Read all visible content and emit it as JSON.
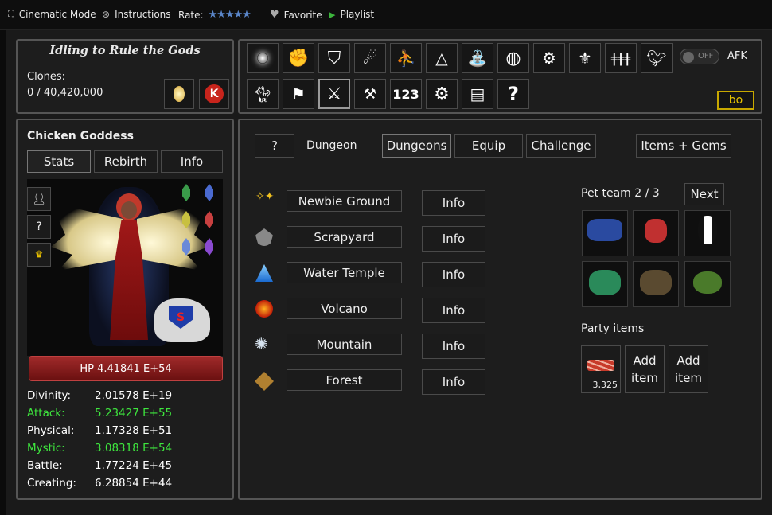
{
  "topbar": {
    "cinematic": "Cinematic Mode",
    "instructions": "Instructions",
    "rate": "Rate:",
    "stars": "★★★★★",
    "favorite": "Favorite",
    "playlist": "Playlist"
  },
  "header": {
    "title": "Idling to Rule the Gods",
    "clones_label": "Clones:",
    "clones_value": "0 / 40,420,000"
  },
  "toolbar": {
    "afk_toggle": "OFF",
    "afk_label": "AFK",
    "bo_label": "bo",
    "number_icon": "123",
    "help_icon": "?"
  },
  "character": {
    "name": "Chicken Goddess",
    "tabs": [
      "Stats",
      "Rebirth",
      "Info"
    ],
    "side_buttons": [
      "person-icon",
      "?",
      "crown-icon"
    ],
    "hp": "HP 4.41841 E+54",
    "stats": [
      {
        "label": "Divinity:",
        "value": "2.01578 E+19",
        "highlight": false
      },
      {
        "label": "Attack:",
        "value": "5.23427 E+55",
        "highlight": true
      },
      {
        "label": "Physical:",
        "value": "1.17328 E+51",
        "highlight": false
      },
      {
        "label": "Mystic:",
        "value": "3.08318 E+54",
        "highlight": true
      },
      {
        "label": "Battle:",
        "value": "1.77224 E+45",
        "highlight": false
      },
      {
        "label": "Creating:",
        "value": "6.28854 E+44",
        "highlight": false
      }
    ],
    "colors": {
      "highlight": "#3ee63e",
      "hp_bar": "#8b1d1d"
    }
  },
  "dungeon": {
    "help_button": "?",
    "title": "Dungeon",
    "tabs": [
      "Dungeons",
      "Equip",
      "Challenge"
    ],
    "items_gems": "Items + Gems",
    "list": [
      {
        "name": "Newbie Ground",
        "info": "Info",
        "icon": "sparkle-icon"
      },
      {
        "name": "Scrapyard",
        "info": "Info",
        "icon": "scrap-icon"
      },
      {
        "name": "Water Temple",
        "info": "Info",
        "icon": "water-icon"
      },
      {
        "name": "Volcano",
        "info": "Info",
        "icon": "fire-icon"
      },
      {
        "name": "Mountain",
        "info": "Info",
        "icon": "snow-icon"
      },
      {
        "name": "Forest",
        "info": "Info",
        "icon": "forest-icon"
      }
    ],
    "pet_team": "Pet team 2 / 3",
    "next": "Next",
    "party_items": "Party items",
    "item_count": "3,325",
    "add_item_line1": "Add",
    "add_item_line2": "item"
  }
}
